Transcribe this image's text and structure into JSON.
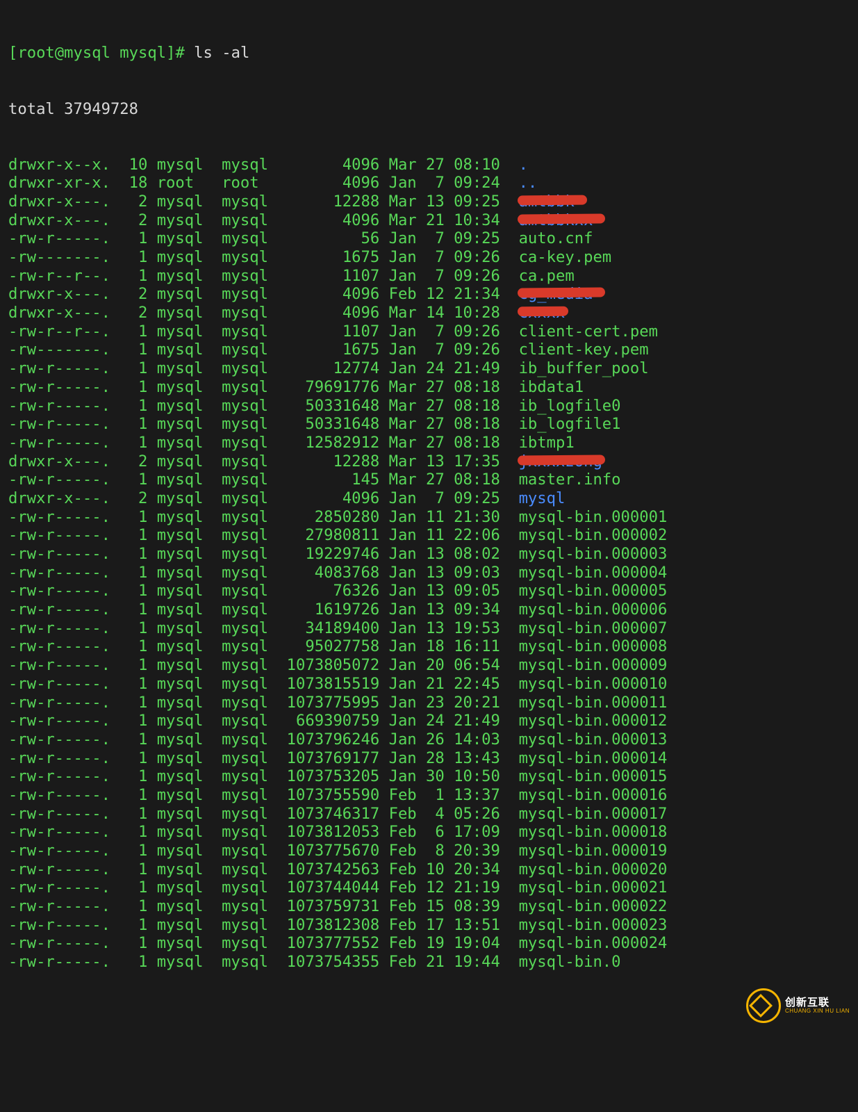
{
  "prompt": "[root@mysql mysql]# ",
  "command": "ls -al",
  "total_line": "total 37949728",
  "columns": [
    "perms",
    "links",
    "owner",
    "group",
    "size",
    "date",
    "name"
  ],
  "rows": [
    {
      "perms": "drwxr-x--x.",
      "links": "10",
      "owner": "mysql",
      "group": "mysql",
      "size": "4096",
      "date": "Mar 27 08:10",
      "name": ".",
      "cls": "dir"
    },
    {
      "perms": "drwxr-xr-x.",
      "links": "18",
      "owner": "root ",
      "group": "root ",
      "size": "4096",
      "date": "Jan  7 09:24",
      "name": "..",
      "cls": "dir"
    },
    {
      "perms": "drwxr-x---.",
      "links": "2",
      "owner": "mysql",
      "group": "mysql",
      "size": "12288",
      "date": "Mar 13 09:25",
      "name": "amtbbk ",
      "cls": "redact"
    },
    {
      "perms": "drwxr-x---.",
      "links": "2",
      "owner": "mysql",
      "group": "mysql",
      "size": "4096",
      "date": "Mar 21 10:34",
      "name": "amtbbkxx ",
      "cls": "redact"
    },
    {
      "perms": "-rw-r-----.",
      "links": "1",
      "owner": "mysql",
      "group": "mysql",
      "size": "56",
      "date": "Jan  7 09:25",
      "name": "auto.cnf",
      "cls": "plain"
    },
    {
      "perms": "-rw-------.",
      "links": "1",
      "owner": "mysql",
      "group": "mysql",
      "size": "1675",
      "date": "Jan  7 09:26",
      "name": "ca-key.pem",
      "cls": "plain"
    },
    {
      "perms": "-rw-r--r--.",
      "links": "1",
      "owner": "mysql",
      "group": "mysql",
      "size": "1107",
      "date": "Jan  7 09:26",
      "name": "ca.pem",
      "cls": "plain"
    },
    {
      "perms": "drwxr-x---.",
      "links": "2",
      "owner": "mysql",
      "group": "mysql",
      "size": "4096",
      "date": "Feb 12 21:34",
      "name": "cg_media ",
      "cls": "redact"
    },
    {
      "perms": "drwxr-x---.",
      "links": "2",
      "owner": "mysql",
      "group": "mysql",
      "size": "4096",
      "date": "Mar 14 10:28",
      "name": "cxxxx",
      "cls": "redact"
    },
    {
      "perms": "-rw-r--r--.",
      "links": "1",
      "owner": "mysql",
      "group": "mysql",
      "size": "1107",
      "date": "Jan  7 09:26",
      "name": "client-cert.pem",
      "cls": "plain"
    },
    {
      "perms": "-rw-------.",
      "links": "1",
      "owner": "mysql",
      "group": "mysql",
      "size": "1675",
      "date": "Jan  7 09:26",
      "name": "client-key.pem",
      "cls": "plain"
    },
    {
      "perms": "-rw-r-----.",
      "links": "1",
      "owner": "mysql",
      "group": "mysql",
      "size": "12774",
      "date": "Jan 24 21:49",
      "name": "ib_buffer_pool",
      "cls": "plain"
    },
    {
      "perms": "-rw-r-----.",
      "links": "1",
      "owner": "mysql",
      "group": "mysql",
      "size": "79691776",
      "date": "Mar 27 08:18",
      "name": "ibdata1",
      "cls": "plain"
    },
    {
      "perms": "-rw-r-----.",
      "links": "1",
      "owner": "mysql",
      "group": "mysql",
      "size": "50331648",
      "date": "Mar 27 08:18",
      "name": "ib_logfile0",
      "cls": "plain"
    },
    {
      "perms": "-rw-r-----.",
      "links": "1",
      "owner": "mysql",
      "group": "mysql",
      "size": "50331648",
      "date": "Mar 27 08:18",
      "name": "ib_logfile1",
      "cls": "plain"
    },
    {
      "perms": "-rw-r-----.",
      "links": "1",
      "owner": "mysql",
      "group": "mysql",
      "size": "12582912",
      "date": "Mar 27 08:18",
      "name": "ibtmp1",
      "cls": "plain"
    },
    {
      "perms": "drwxr-x---.",
      "links": "2",
      "owner": "mysql",
      "group": "mysql",
      "size": "12288",
      "date": "Mar 13 17:35",
      "name": "jxxxxzong",
      "cls": "redact"
    },
    {
      "perms": "-rw-r-----.",
      "links": "1",
      "owner": "mysql",
      "group": "mysql",
      "size": "145",
      "date": "Mar 27 08:18",
      "name": "master.info",
      "cls": "plain"
    },
    {
      "perms": "drwxr-x---.",
      "links": "2",
      "owner": "mysql",
      "group": "mysql",
      "size": "4096",
      "date": "Jan  7 09:25",
      "name": "mysql",
      "cls": "dir"
    },
    {
      "perms": "-rw-r-----.",
      "links": "1",
      "owner": "mysql",
      "group": "mysql",
      "size": "2850280",
      "date": "Jan 11 21:30",
      "name": "mysql-bin.000001",
      "cls": "plain"
    },
    {
      "perms": "-rw-r-----.",
      "links": "1",
      "owner": "mysql",
      "group": "mysql",
      "size": "27980811",
      "date": "Jan 11 22:06",
      "name": "mysql-bin.000002",
      "cls": "plain"
    },
    {
      "perms": "-rw-r-----.",
      "links": "1",
      "owner": "mysql",
      "group": "mysql",
      "size": "19229746",
      "date": "Jan 13 08:02",
      "name": "mysql-bin.000003",
      "cls": "plain"
    },
    {
      "perms": "-rw-r-----.",
      "links": "1",
      "owner": "mysql",
      "group": "mysql",
      "size": "4083768",
      "date": "Jan 13 09:03",
      "name": "mysql-bin.000004",
      "cls": "plain"
    },
    {
      "perms": "-rw-r-----.",
      "links": "1",
      "owner": "mysql",
      "group": "mysql",
      "size": "76326",
      "date": "Jan 13 09:05",
      "name": "mysql-bin.000005",
      "cls": "plain"
    },
    {
      "perms": "-rw-r-----.",
      "links": "1",
      "owner": "mysql",
      "group": "mysql",
      "size": "1619726",
      "date": "Jan 13 09:34",
      "name": "mysql-bin.000006",
      "cls": "plain"
    },
    {
      "perms": "-rw-r-----.",
      "links": "1",
      "owner": "mysql",
      "group": "mysql",
      "size": "34189400",
      "date": "Jan 13 19:53",
      "name": "mysql-bin.000007",
      "cls": "plain"
    },
    {
      "perms": "-rw-r-----.",
      "links": "1",
      "owner": "mysql",
      "group": "mysql",
      "size": "95027758",
      "date": "Jan 18 16:11",
      "name": "mysql-bin.000008",
      "cls": "plain"
    },
    {
      "perms": "-rw-r-----.",
      "links": "1",
      "owner": "mysql",
      "group": "mysql",
      "size": "1073805072",
      "date": "Jan 20 06:54",
      "name": "mysql-bin.000009",
      "cls": "plain"
    },
    {
      "perms": "-rw-r-----.",
      "links": "1",
      "owner": "mysql",
      "group": "mysql",
      "size": "1073815519",
      "date": "Jan 21 22:45",
      "name": "mysql-bin.000010",
      "cls": "plain"
    },
    {
      "perms": "-rw-r-----.",
      "links": "1",
      "owner": "mysql",
      "group": "mysql",
      "size": "1073775995",
      "date": "Jan 23 20:21",
      "name": "mysql-bin.000011",
      "cls": "plain"
    },
    {
      "perms": "-rw-r-----.",
      "links": "1",
      "owner": "mysql",
      "group": "mysql",
      "size": "669390759",
      "date": "Jan 24 21:49",
      "name": "mysql-bin.000012",
      "cls": "plain"
    },
    {
      "perms": "-rw-r-----.",
      "links": "1",
      "owner": "mysql",
      "group": "mysql",
      "size": "1073796246",
      "date": "Jan 26 14:03",
      "name": "mysql-bin.000013",
      "cls": "plain"
    },
    {
      "perms": "-rw-r-----.",
      "links": "1",
      "owner": "mysql",
      "group": "mysql",
      "size": "1073769177",
      "date": "Jan 28 13:43",
      "name": "mysql-bin.000014",
      "cls": "plain"
    },
    {
      "perms": "-rw-r-----.",
      "links": "1",
      "owner": "mysql",
      "group": "mysql",
      "size": "1073753205",
      "date": "Jan 30 10:50",
      "name": "mysql-bin.000015",
      "cls": "plain"
    },
    {
      "perms": "-rw-r-----.",
      "links": "1",
      "owner": "mysql",
      "group": "mysql",
      "size": "1073755590",
      "date": "Feb  1 13:37",
      "name": "mysql-bin.000016",
      "cls": "plain"
    },
    {
      "perms": "-rw-r-----.",
      "links": "1",
      "owner": "mysql",
      "group": "mysql",
      "size": "1073746317",
      "date": "Feb  4 05:26",
      "name": "mysql-bin.000017",
      "cls": "plain"
    },
    {
      "perms": "-rw-r-----.",
      "links": "1",
      "owner": "mysql",
      "group": "mysql",
      "size": "1073812053",
      "date": "Feb  6 17:09",
      "name": "mysql-bin.000018",
      "cls": "plain"
    },
    {
      "perms": "-rw-r-----.",
      "links": "1",
      "owner": "mysql",
      "group": "mysql",
      "size": "1073775670",
      "date": "Feb  8 20:39",
      "name": "mysql-bin.000019",
      "cls": "plain"
    },
    {
      "perms": "-rw-r-----.",
      "links": "1",
      "owner": "mysql",
      "group": "mysql",
      "size": "1073742563",
      "date": "Feb 10 20:34",
      "name": "mysql-bin.000020",
      "cls": "plain"
    },
    {
      "perms": "-rw-r-----.",
      "links": "1",
      "owner": "mysql",
      "group": "mysql",
      "size": "1073744044",
      "date": "Feb 12 21:19",
      "name": "mysql-bin.000021",
      "cls": "plain"
    },
    {
      "perms": "-rw-r-----.",
      "links": "1",
      "owner": "mysql",
      "group": "mysql",
      "size": "1073759731",
      "date": "Feb 15 08:39",
      "name": "mysql-bin.000022",
      "cls": "plain"
    },
    {
      "perms": "-rw-r-----.",
      "links": "1",
      "owner": "mysql",
      "group": "mysql",
      "size": "1073812308",
      "date": "Feb 17 13:51",
      "name": "mysql-bin.000023",
      "cls": "plain"
    },
    {
      "perms": "-rw-r-----.",
      "links": "1",
      "owner": "mysql",
      "group": "mysql",
      "size": "1073777552",
      "date": "Feb 19 19:04",
      "name": "mysql-bin.000024",
      "cls": "plain"
    },
    {
      "perms": "-rw-r-----.",
      "links": "1",
      "owner": "mysql",
      "group": "mysql",
      "size": "1073754355",
      "date": "Feb 21 19:44",
      "name": "mysql-bin.0",
      "cls": "plain"
    }
  ],
  "watermark": {
    "cn": "创新互联",
    "en": "CHUANG XIN HU LIAN"
  }
}
